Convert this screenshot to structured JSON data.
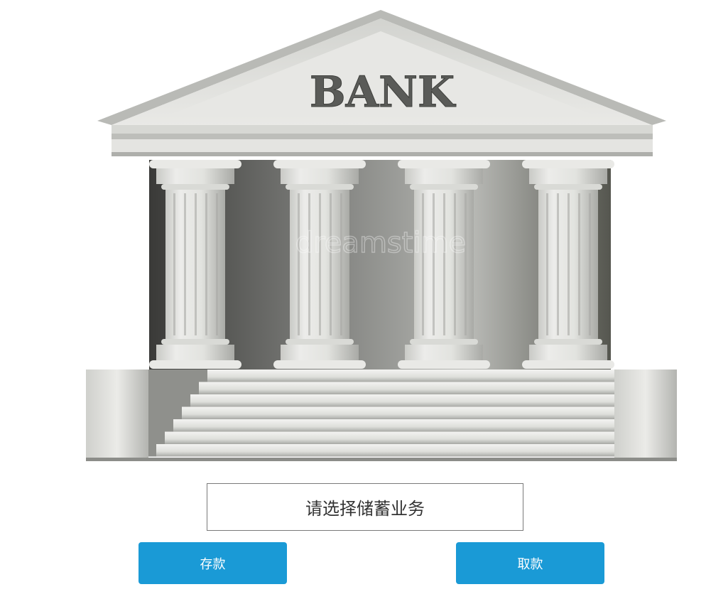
{
  "illustration": {
    "sign_text": "BANK",
    "watermark_text": "dreamstime"
  },
  "prompt": {
    "text": "请选择储蓄业务"
  },
  "actions": {
    "deposit_label": "存款",
    "withdraw_label": "取款"
  },
  "colors": {
    "button_bg": "#1a9ad6",
    "button_text": "#ffffff",
    "prompt_border": "#7a7a7a"
  }
}
